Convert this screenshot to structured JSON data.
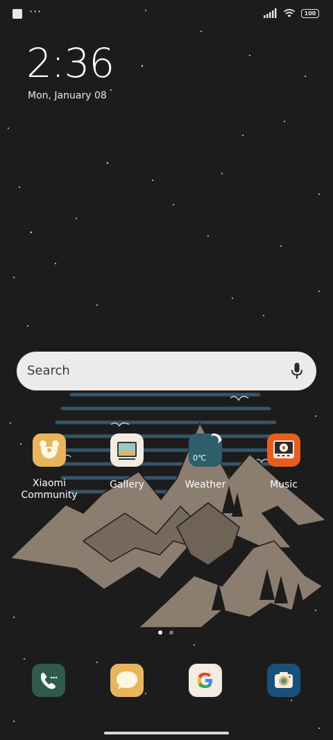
{
  "status_bar": {
    "notification_dots": "···",
    "battery_level": "100"
  },
  "lock": {
    "time": "2:36",
    "date": "Mon, January 08"
  },
  "search": {
    "placeholder": "Search"
  },
  "apps": [
    {
      "label": "Xiaomi\nCommunity",
      "icon": "xiaomi-community-icon",
      "color": "#e9b55c"
    },
    {
      "label": "Gallery",
      "icon": "gallery-icon",
      "color": "#f4ece0"
    },
    {
      "label": "Weather",
      "icon": "weather-icon",
      "color": "#2e5d6b",
      "temp": "0℃"
    },
    {
      "label": "Music",
      "icon": "music-icon",
      "color": "#e85d1e"
    }
  ],
  "dock": [
    {
      "icon": "phone-icon",
      "color": "#2f5b4e"
    },
    {
      "icon": "messages-icon",
      "color": "#e9b55c"
    },
    {
      "icon": "google-icon",
      "color": "#f4ece0"
    },
    {
      "icon": "camera-icon",
      "color": "#17527a"
    }
  ],
  "pager": {
    "pages": 2,
    "current": 1
  }
}
